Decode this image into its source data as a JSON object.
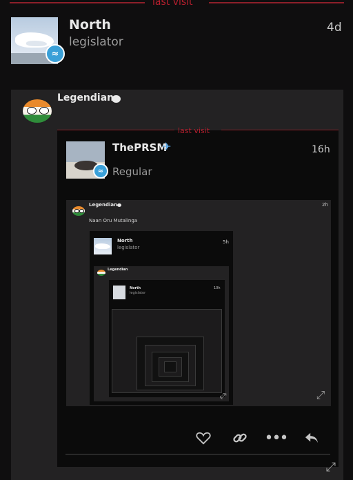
{
  "divider": {
    "label": "last visit"
  },
  "top_post": {
    "name": "North",
    "role": "legislator",
    "time": "4d"
  },
  "quote": {
    "author": "Legendian",
    "inner": {
      "divider_label": "last visit",
      "name": "ThePRSM",
      "role": "Regular",
      "time": "16h",
      "nested": {
        "author": "Legendian",
        "time": "2h",
        "message": "Naan Oru Mutalinga",
        "inner": {
          "name": "North",
          "role": "legislator",
          "time": "5h",
          "nested": {
            "author": "Legendian",
            "inner": {
              "name": "North",
              "role": "legislator",
              "time": "10h"
            }
          }
        }
      }
    }
  },
  "actions": [
    "like",
    "link",
    "more",
    "reply"
  ],
  "icons": {
    "heart": "heart-icon",
    "link": "link-icon",
    "more": "more-icon",
    "reply": "reply-icon",
    "expand": "expand-icon",
    "chat": "chat-bubble-icon",
    "plane": "airplane-icon"
  },
  "colors": {
    "background": "#0f0e0f",
    "divider": "#8d1f2a",
    "panel": "#232223",
    "inner_panel": "#0b0b0b",
    "badge": "#3aa0d8"
  }
}
